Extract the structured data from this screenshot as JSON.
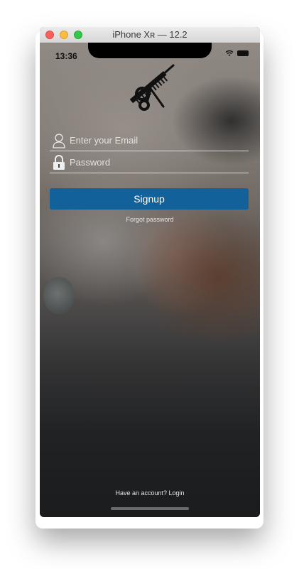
{
  "window": {
    "title": "iPhone Xʀ — 12.2"
  },
  "status_bar": {
    "time": "13:36",
    "icons": [
      "wifi-icon",
      "battery-icon"
    ]
  },
  "logo": {
    "icon": "scissors-comb-icon"
  },
  "form": {
    "email_placeholder": "Enter your Email",
    "password_placeholder": "Password",
    "email_icon": "user-icon",
    "password_icon": "lock-icon"
  },
  "actions": {
    "signup_label": "Signup",
    "forgot_label": "Forgot password",
    "login_prompt": "Have an account? Login"
  },
  "colors": {
    "accent": "#13619a",
    "placeholder": "#ebebeb"
  }
}
